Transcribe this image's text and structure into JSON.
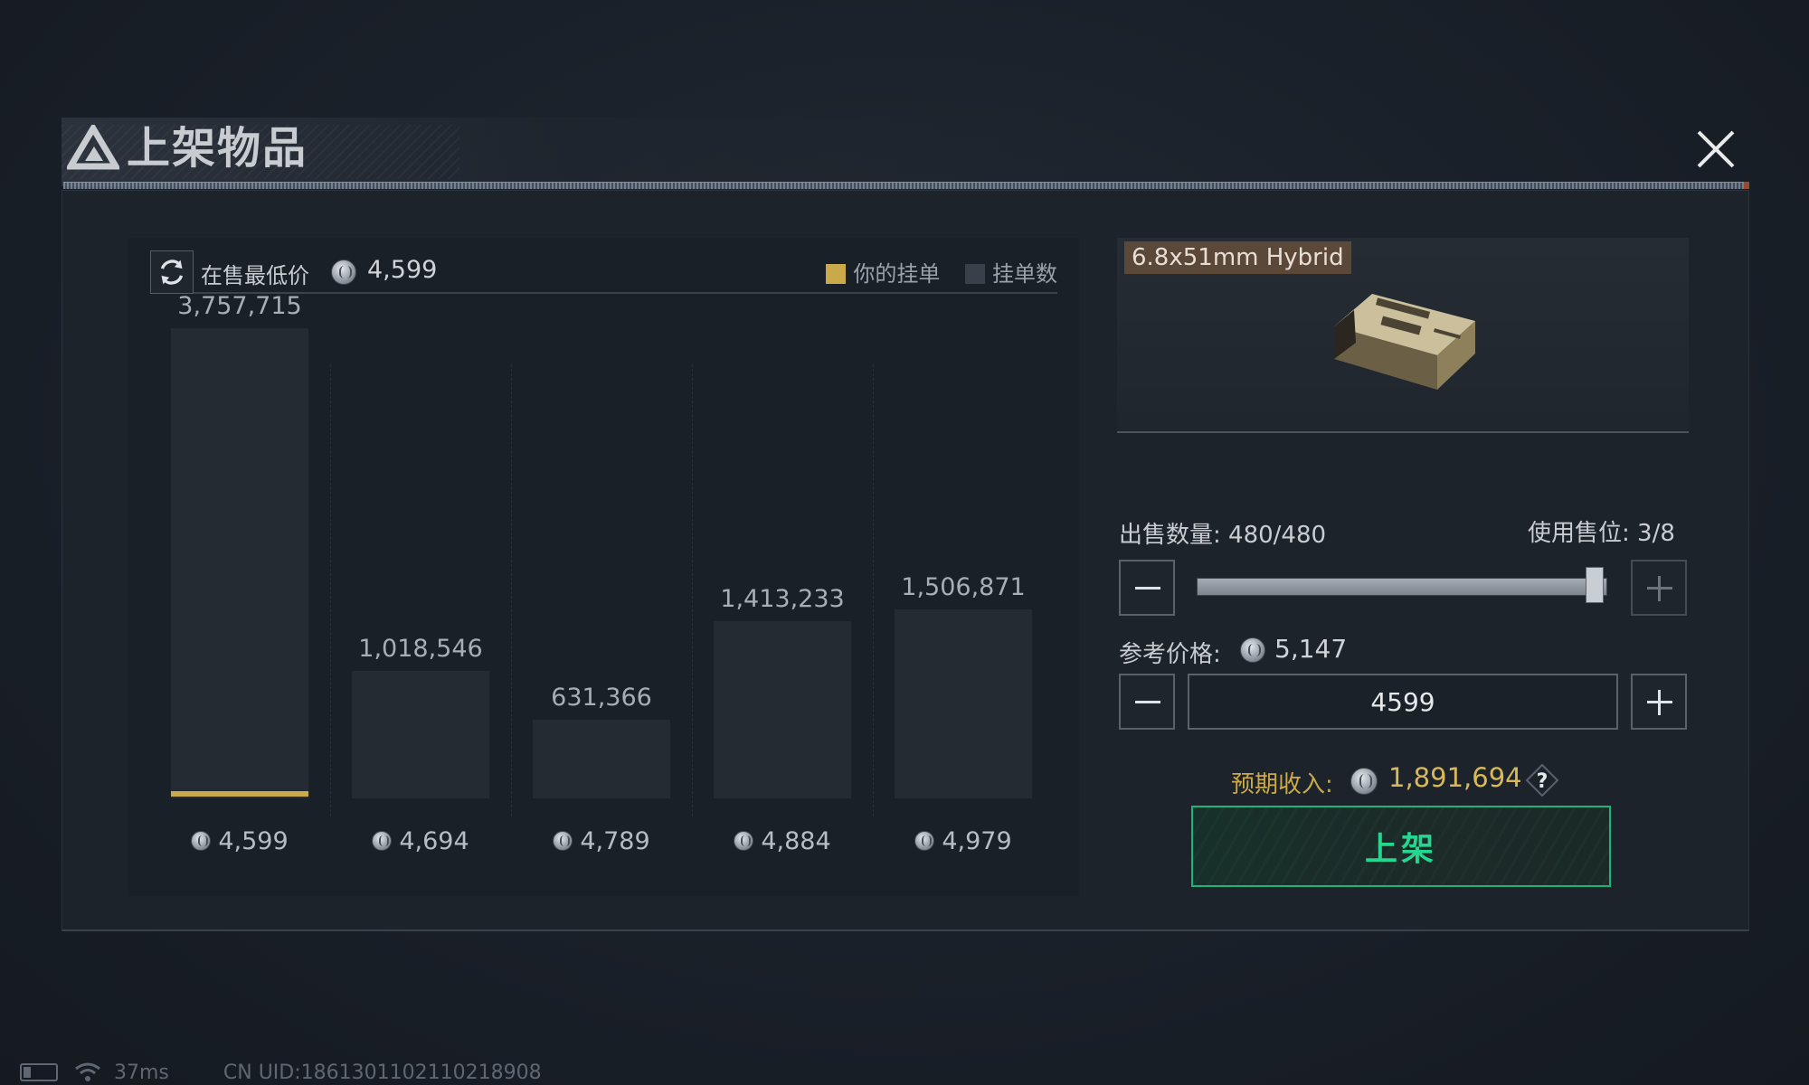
{
  "dialog": {
    "title": "上架物品",
    "close_icon": "close-icon",
    "logo_icon": "delta-logo-icon"
  },
  "market": {
    "refresh_icon": "refresh-icon",
    "lowest_label": "在售最低价",
    "lowest_price": "4,599",
    "legend": {
      "mine": "你的挂单",
      "count": "挂单数"
    }
  },
  "chart_data": {
    "type": "bar",
    "categories": [
      "4,599",
      "4,694",
      "4,789",
      "4,884",
      "4,979"
    ],
    "values": [
      3757715,
      1018546,
      631366,
      1413233,
      1506871
    ],
    "value_labels": [
      "3,757,715",
      "1,018,546",
      "631,366",
      "1,413,233",
      "1,506,871"
    ],
    "series": [
      {
        "name": "挂单数",
        "values": [
          3757715,
          1018546,
          631366,
          1413233,
          1506871
        ]
      }
    ],
    "mine_marker_category": "4,599",
    "colors": {
      "bar": "#252b33",
      "mine": "#c9a94a"
    }
  },
  "item": {
    "name": "6.8x51mm Hybrid",
    "image_icon": "ammo-box-icon"
  },
  "sell": {
    "qty_label": "出售数量: 480/480",
    "slots_label": "使用售位: 3/8",
    "qty_fraction": 1.0,
    "ref_label": "参考价格:",
    "ref_price": "5,147",
    "price_value": "4599",
    "expected_label": "预期收入:",
    "expected_value": "1,891,694",
    "help_icon": "question-icon",
    "submit_label": "上架"
  },
  "status": {
    "latency": "37ms",
    "uid": "CN UID:1861301102110218908"
  },
  "colors": {
    "accent_gold": "#c9a94a",
    "accent_green": "#25d68e"
  }
}
